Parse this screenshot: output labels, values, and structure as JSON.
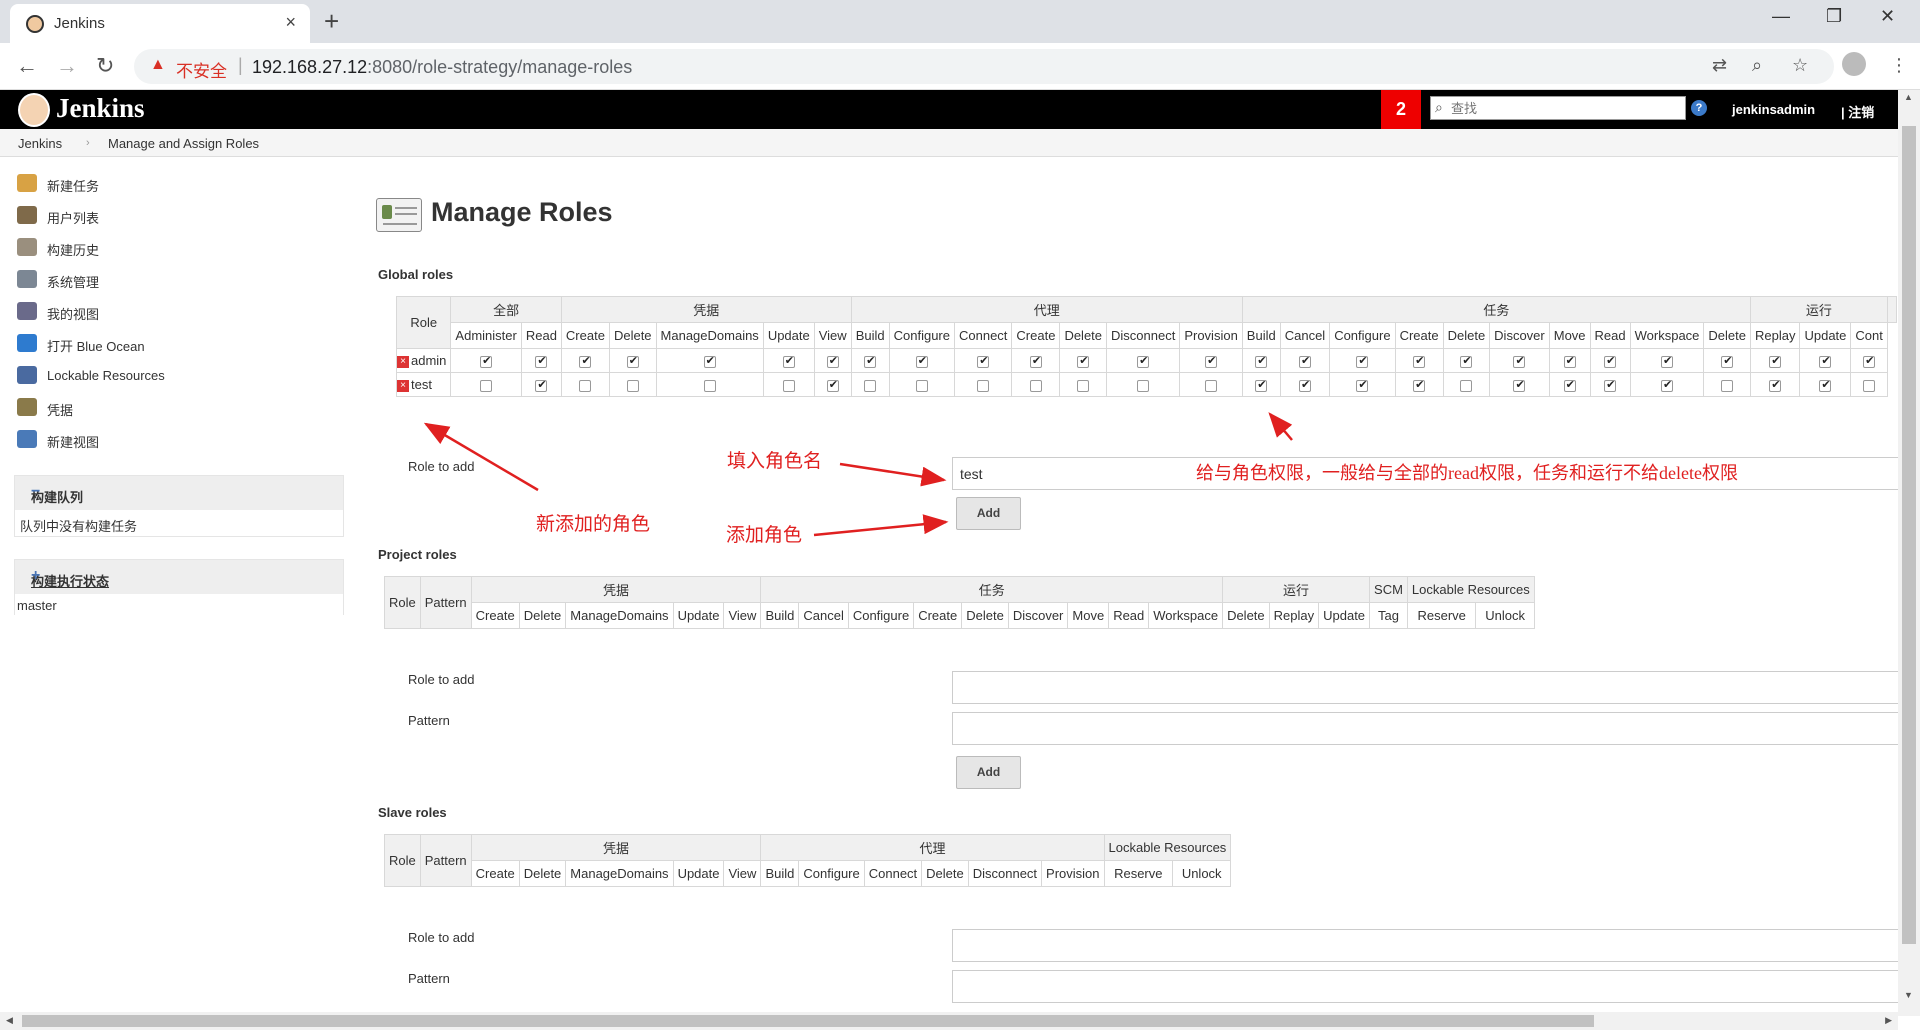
{
  "browser": {
    "tab_title": "Jenkins",
    "tab_close": "×",
    "new_tab": "+",
    "insecure_label": "不安全",
    "url_host": "192.168.27.12",
    "url_rest": ":8080/role-strategy/manage-roles",
    "window_minimize": "—",
    "window_restore": "❐",
    "window_close": "✕"
  },
  "header": {
    "brand": "Jenkins",
    "notification_count": "2",
    "search_placeholder": "查找",
    "help": "?",
    "username": "jenkinsadmin",
    "logout": "| 注销"
  },
  "breadcrumb": {
    "root": "Jenkins",
    "sep": "›",
    "current": "Manage and Assign Roles"
  },
  "sidebar": {
    "items": [
      {
        "label": "新建任务",
        "color": "#d8a244"
      },
      {
        "label": "用户列表",
        "color": "#7f6a4a"
      },
      {
        "label": "构建历史",
        "color": "#9a8f7e"
      },
      {
        "label": "系统管理",
        "color": "#7c8794"
      },
      {
        "label": "我的视图",
        "color": "#6a6a8a"
      },
      {
        "label": "打开 Blue Ocean",
        "color": "#2e7bcf"
      },
      {
        "label": "Lockable Resources",
        "color": "#4a6aa0"
      },
      {
        "label": "凭据",
        "color": "#8a7a4a"
      },
      {
        "label": "新建视图",
        "color": "#4a7ab8"
      }
    ],
    "build_queue": {
      "title": "构建队列",
      "toggle": "−",
      "empty": "队列中没有构建任务"
    },
    "executor": {
      "title": "构建执行状态",
      "toggle": "+",
      "node": "master"
    }
  },
  "page": {
    "title": "Manage Roles",
    "role_to_add": "Role to add",
    "pattern": "Pattern",
    "add": "Add",
    "new_role_value": "test"
  },
  "global_roles": {
    "heading": "Global roles",
    "role_col": "Role",
    "categories": [
      {
        "name": "全部",
        "span": 2
      },
      {
        "name": "凭据",
        "span": 5
      },
      {
        "name": "代理",
        "span": 7
      },
      {
        "name": "任务",
        "span": 10
      },
      {
        "name": "运行",
        "span": 3
      },
      {
        "name": "",
        "span": 1
      }
    ],
    "permissions": [
      "Administer",
      "Read",
      "Create",
      "Delete",
      "ManageDomains",
      "Update",
      "View",
      "Build",
      "Configure",
      "Connect",
      "Create",
      "Delete",
      "Disconnect",
      "Provision",
      "Build",
      "Cancel",
      "Configure",
      "Create",
      "Delete",
      "Discover",
      "Move",
      "Read",
      "Workspace",
      "Delete",
      "Replay",
      "Update",
      "Cont"
    ],
    "rows": [
      {
        "name": "admin",
        "checks": [
          1,
          1,
          1,
          1,
          1,
          1,
          1,
          1,
          1,
          1,
          1,
          1,
          1,
          1,
          1,
          1,
          1,
          1,
          1,
          1,
          1,
          1,
          1,
          1,
          1,
          1,
          1
        ]
      },
      {
        "name": "test",
        "checks": [
          0,
          1,
          0,
          0,
          0,
          0,
          1,
          0,
          0,
          0,
          0,
          0,
          0,
          0,
          1,
          1,
          1,
          1,
          0,
          1,
          1,
          1,
          1,
          0,
          1,
          1,
          0
        ]
      }
    ]
  },
  "project_roles": {
    "heading": "Project roles",
    "role_col": "Role",
    "pattern_col": "Pattern",
    "categories": [
      {
        "name": "凭据",
        "span": 5
      },
      {
        "name": "任务",
        "span": 9
      },
      {
        "name": "运行",
        "span": 3
      },
      {
        "name": "SCM",
        "span": 1
      },
      {
        "name": "Lockable Resources",
        "span": 2
      }
    ],
    "permissions": [
      "Create",
      "Delete",
      "ManageDomains",
      "Update",
      "View",
      "Build",
      "Cancel",
      "Configure",
      "Create",
      "Delete",
      "Discover",
      "Move",
      "Read",
      "Workspace",
      "Delete",
      "Replay",
      "Update",
      "Tag",
      "Reserve",
      "Unlock"
    ]
  },
  "slave_roles": {
    "heading": "Slave roles",
    "role_col": "Role",
    "pattern_col": "Pattern",
    "categories": [
      {
        "name": "凭据",
        "span": 5
      },
      {
        "name": "代理",
        "span": 6
      },
      {
        "name": "Lockable Resources",
        "span": 2
      }
    ],
    "permissions": [
      "Create",
      "Delete",
      "ManageDomains",
      "Update",
      "View",
      "Build",
      "Configure",
      "Connect",
      "Delete",
      "Disconnect",
      "Provision",
      "Reserve",
      "Unlock"
    ]
  },
  "annotations": {
    "fill_role_name": "填入角色名",
    "permission_note": "给与角色权限，一般给与全部的read权限，任务和运行不给delete权限",
    "new_role": "新添加的角色",
    "add_role": "添加角色",
    "color": "#e02020"
  }
}
